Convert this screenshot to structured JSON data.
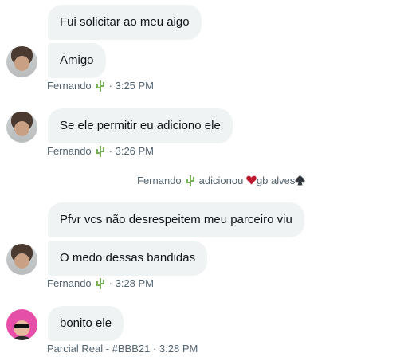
{
  "messages": [
    {
      "text": "Fui solicitar ao meu aigo"
    },
    {
      "text": "Amigo"
    },
    {
      "text": "Se ele permitir eu adiciono ele"
    },
    {
      "text": "Pfvr vcs não desrespeitem meu parceiro viu"
    },
    {
      "text": "O medo dessas bandidas"
    },
    {
      "text": "bonito ele"
    }
  ],
  "meta": [
    {
      "sender": "Fernando",
      "time": "· 3:25 PM"
    },
    {
      "sender": "Fernando",
      "time": "· 3:26 PM"
    },
    {
      "sender": "Fernando",
      "time": "· 3:28 PM"
    },
    {
      "sender": "Parcial Real - #BBB21",
      "time": "· 3:28 PM"
    }
  ],
  "system_event": {
    "actor": "Fernando",
    "action": "adicionou",
    "target": "gb alves"
  },
  "colors": {
    "bubble": "#eff3f4",
    "meta_text": "#536471",
    "cactus": "#77b255",
    "heart": "#be1931",
    "spade": "#31373d"
  },
  "icons": {
    "cactus": "cactus-emoji-icon",
    "heart": "heart-suit-icon",
    "spade": "spade-suit-icon"
  }
}
